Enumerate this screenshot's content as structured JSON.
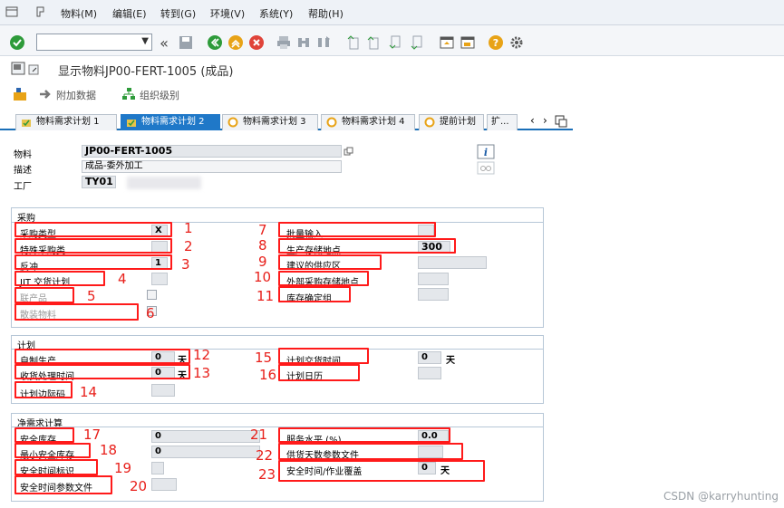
{
  "menu": {
    "items": [
      "物料(M)",
      "编辑(E)",
      "转到(G)",
      "环境(V)",
      "系统(Y)",
      "帮助(H)"
    ]
  },
  "screen": {
    "title": "显示物料JP00-FERT-1005 (成品)"
  },
  "apptoolbar": {
    "additional_data": "附加数据",
    "org_levels": "组织级别"
  },
  "tabs": [
    "物料需求计划 1",
    "物料需求计划 2",
    "物料需求计划 3",
    "物料需求计划 4",
    "提前计划",
    "扩..."
  ],
  "header": {
    "material_label": "物料",
    "material_value": "JP00-FERT-1005",
    "desc_label": "描述",
    "desc_value": "成品-委外加工",
    "plant_label": "工厂",
    "plant_value": "TY01"
  },
  "procurement": {
    "title": "采购",
    "proc_type_label": "采购类型",
    "proc_type_value": "X",
    "special_proc_label": "特殊采购类",
    "backflush_label": "反冲",
    "backflush_value": "1",
    "jit_label": "JIT 交货计划",
    "coproduct_label": "联产品",
    "bulk_label": "散装物料",
    "batch_entry_label": "批量输入",
    "prod_sloc_label": "生产存储地点",
    "prod_sloc_value": "300",
    "supply_area_label": "建议的供应区",
    "ext_sloc_label": "外部采购存储地点",
    "stock_det_label": "库存确定组"
  },
  "scheduling": {
    "title": "计划",
    "inhouse_label": "自制生产",
    "inhouse_value": "0",
    "gr_time_label": "收货处理时间",
    "gr_time_value": "0",
    "sm_key_label": "计划边际码",
    "pdt_label": "计划交货时间",
    "pdt_value": "0",
    "calendar_label": "计划日历",
    "unit_days": "天"
  },
  "netreq": {
    "title": "净需求计算",
    "safety_stock_label": "安全库存",
    "safety_stock_value": "0",
    "min_ss_label": "最小安全库存",
    "min_ss_value": "0",
    "st_ind_label": "安全时间标识",
    "st_profile_label": "安全时间参数文件",
    "service_level_label": "服务水平 (%)",
    "service_level_value": "0.0",
    "coverage_profile_label": "供货天数参数文件",
    "st_coverage_label": "安全时间/作业覆盖",
    "st_coverage_value": "0",
    "unit_days": "天"
  },
  "annotations": [
    "1",
    "2",
    "3",
    "4",
    "5",
    "6",
    "7",
    "8",
    "9",
    "10",
    "11",
    "12",
    "13",
    "14",
    "15",
    "16",
    "17",
    "18",
    "19",
    "20",
    "21",
    "22",
    "23"
  ],
  "watermark": "CSDN @karryhunting",
  "colors": {
    "accent": "#1f78c8",
    "annotation": "#ff1a1a"
  }
}
